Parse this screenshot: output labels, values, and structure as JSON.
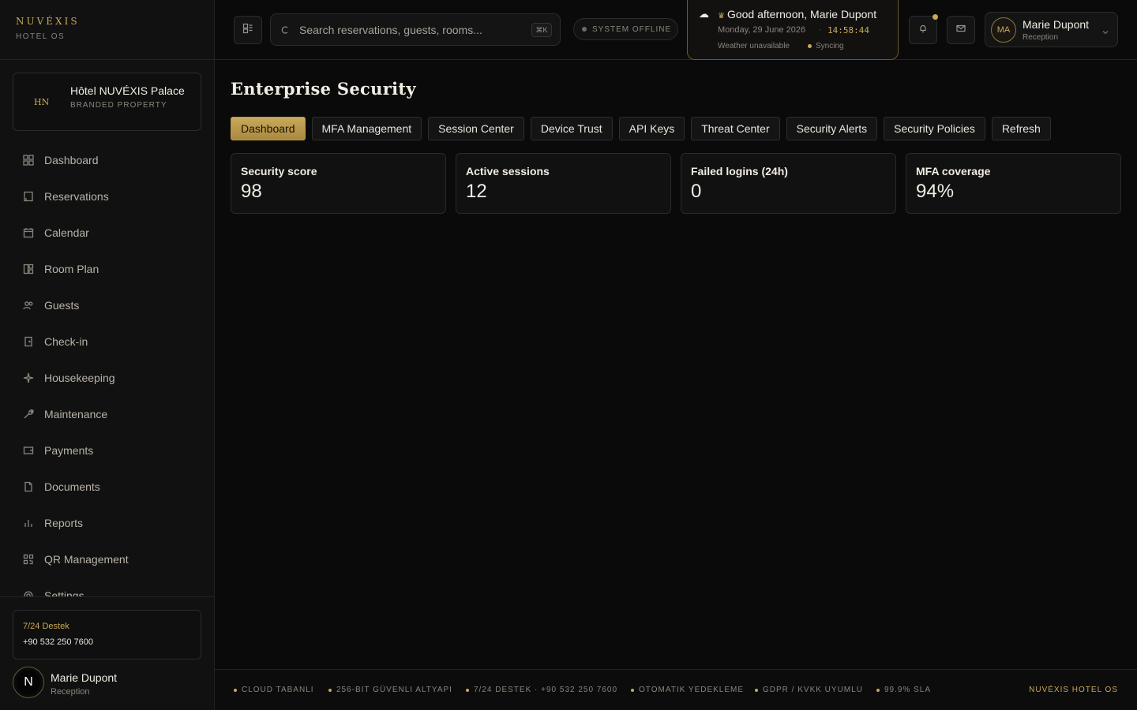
{
  "brand": {
    "name": "NUVÉXIS",
    "subtitle": "HOTEL OS"
  },
  "property": {
    "monogram": "HN",
    "name": "Hôtel NUVÉXIS Palace",
    "type": "BRANDED PROPERTY"
  },
  "sidebar": {
    "items": [
      {
        "label": "Dashboard",
        "icon": "dashboard-icon"
      },
      {
        "label": "Reservations",
        "icon": "book-icon"
      },
      {
        "label": "Calendar",
        "icon": "calendar-icon"
      },
      {
        "label": "Room Plan",
        "icon": "room-plan-icon"
      },
      {
        "label": "Guests",
        "icon": "users-icon"
      },
      {
        "label": "Check-in",
        "icon": "door-icon"
      },
      {
        "label": "Housekeeping",
        "icon": "sparkle-icon"
      },
      {
        "label": "Maintenance",
        "icon": "wrench-icon"
      },
      {
        "label": "Payments",
        "icon": "wallet-icon"
      },
      {
        "label": "Documents",
        "icon": "document-icon"
      },
      {
        "label": "Reports",
        "icon": "bar-chart-icon"
      },
      {
        "label": "QR Management",
        "icon": "qr-icon"
      },
      {
        "label": "Settings",
        "icon": "gear-icon"
      }
    ]
  },
  "support": {
    "title": "7/24 Destek",
    "phone": "+90 532 250 7600"
  },
  "side_user": {
    "initial": "N",
    "name": "Marie Dupont",
    "role": "Reception"
  },
  "topbar": {
    "search_placeholder": "Search reservations, guests, rooms...",
    "shortcut": "⌘K",
    "status": "SYSTEM OFFLINE",
    "greeting": "Good afternoon, Marie Dupont",
    "date": "Monday, 29 June 2026",
    "time": "14:58:44",
    "weather": "Weather unavailable",
    "sync": "Syncing",
    "user": {
      "initials": "MA",
      "name": "Marie Dupont",
      "role": "Reception"
    }
  },
  "main": {
    "title": "Enterprise Security",
    "tabs": [
      "Dashboard",
      "MFA Management",
      "Session Center",
      "Device Trust",
      "API Keys",
      "Threat Center",
      "Security Alerts",
      "Security Policies",
      "Refresh"
    ],
    "active_tab": "Dashboard",
    "cards": [
      {
        "label": "Security score",
        "value": "98"
      },
      {
        "label": "Active sessions",
        "value": "12"
      },
      {
        "label": "Failed logins (24h)",
        "value": "0"
      },
      {
        "label": "MFA coverage",
        "value": "94%"
      }
    ]
  },
  "footer": {
    "items": [
      "CLOUD TABANLI",
      "256-BIT GÜVENLI ALTYAPI",
      "7/24 DESTEK · +90 532 250 7600",
      "OTOMATIK YEDEKLEME",
      "GDPR / KVKK UYUMLU",
      "99.9% SLA"
    ],
    "brand": "NUVÉXIS HOTEL OS"
  },
  "colors": {
    "accent": "#c9a95a",
    "background": "#0a0a0a",
    "panel": "#111111"
  }
}
